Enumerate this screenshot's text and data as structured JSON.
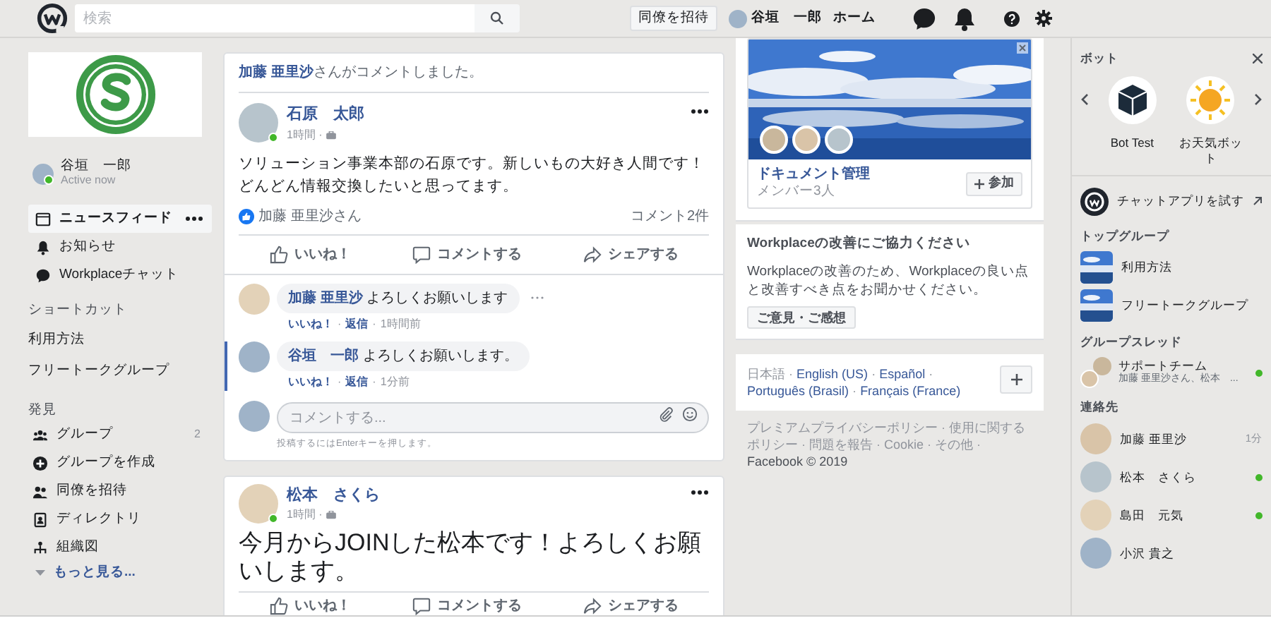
{
  "topbar": {
    "search_placeholder": "検索",
    "invite": "同僚を招待",
    "user": "谷垣　一郎",
    "home": "ホーム"
  },
  "sidebar": {
    "user": {
      "name": "谷垣　一郎",
      "status": "Active now",
      "online": true
    },
    "nav": [
      {
        "label": "ニュースフィード",
        "selected": true,
        "kind": "feed"
      },
      {
        "label": "お知らせ",
        "selected": false,
        "kind": "bell"
      },
      {
        "label": "Workplaceチャット",
        "selected": false,
        "kind": "chat"
      }
    ],
    "shortcuts_title": "ショートカット",
    "shortcuts": [
      "利用方法",
      "フリートークグループ"
    ],
    "discover_title": "発見",
    "discover": [
      {
        "label": "グループ",
        "count": "2",
        "kind": "group"
      },
      {
        "label": "グループを作成",
        "kind": "plus"
      },
      {
        "label": "同僚を招待",
        "kind": "invite"
      },
      {
        "label": "ディレクトリ",
        "kind": "directory"
      },
      {
        "label": "組織図",
        "kind": "org"
      }
    ],
    "more": "もっと見る..."
  },
  "posts": [
    {
      "notice_name": "加藤 亜里沙",
      "notice_text": "さんがコメントしました。",
      "author": "石原　太郎",
      "time": "1時間 ·",
      "online": true,
      "large": false,
      "body": "ソリューション事業本部の石原です。新しいもの大好き人間です！どんどん情報交換したいと思ってます。",
      "likes": "加藤 亜里沙さん",
      "comment_count": "コメント2件",
      "actions": [
        "いいね！",
        "コメントする",
        "シェアする"
      ],
      "comments": [
        {
          "name": "加藤 亜里沙",
          "text": "よろしくお願いします",
          "like": "いいね！",
          "sep1": "·",
          "reply": "返信",
          "sep2": "·",
          "time": "1時間前",
          "highlighted": false
        },
        {
          "name": "谷垣　一郎",
          "text": "よろしくお願いします。",
          "like": "いいね！",
          "sep1": "·",
          "reply": "返信",
          "sep2": "·",
          "time": "1分前",
          "highlighted": true
        }
      ],
      "comment_placeholder": "コメントする...",
      "hint": "投稿するにはEnterキーを押します。"
    },
    {
      "author": "松本　さくら",
      "time": "1時間 ·",
      "online": true,
      "large": true,
      "body": "今月からJOINした松本です！よろしくお願いします。",
      "actions": [
        "いいね！",
        "コメントする",
        "シェアする"
      ]
    }
  ],
  "group_card": {
    "title": "ドキュメント管理",
    "members": "メンバー3人",
    "join": "参加"
  },
  "survey": {
    "title": "Workplaceの改善にご協力ください",
    "body": "Workplaceの改善のため、Workplaceの良い点と改善すべき点をお聞かせください。",
    "button": "ご意見・ご感想"
  },
  "languages": {
    "current": "日本語",
    "links": [
      {
        "sep": "·",
        "label": "English (US)"
      },
      {
        "sep": "·",
        "label": "Español"
      },
      {
        "sep": "·",
        "label": "Português (Brasil)"
      },
      {
        "sep": "·",
        "label": "Français (France)"
      }
    ]
  },
  "footer": {
    "links": "プレミアムプライバシーポリシー · 使用に関するポリシー · 問題を報告 · Cookie · その他 ·",
    "copyright": "Facebook © 2019"
  },
  "rail": {
    "bots_title": "ボット",
    "bots": [
      {
        "name": "Bot Test",
        "kind": "cube"
      },
      {
        "name": "お天気ボット",
        "kind": "sun"
      }
    ],
    "try_chat": "チャットアプリを試す",
    "groups_title": "トップグループ",
    "groups": [
      "利用方法",
      "フリートークグループ"
    ],
    "threads_title": "グループスレッド",
    "threads": [
      {
        "name": "サポートチーム",
        "members": "加藤 亜里沙さん、松本　...",
        "online": true
      }
    ],
    "contacts_title": "連絡先",
    "contacts": [
      {
        "name": "加藤 亜里沙",
        "time": "1分",
        "online": false
      },
      {
        "name": "松本　さくら",
        "online": true
      },
      {
        "name": "島田　元気",
        "online": true
      },
      {
        "name": "小沢 貴之",
        "online": false
      }
    ]
  }
}
